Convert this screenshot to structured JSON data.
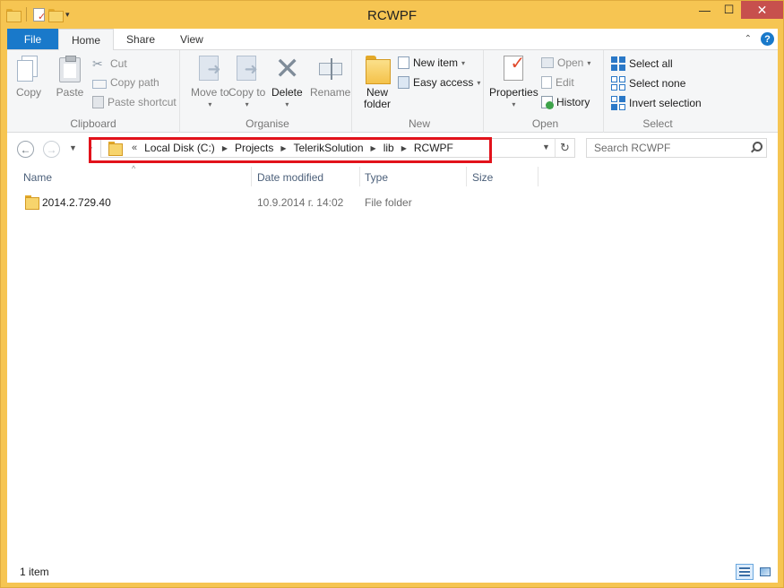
{
  "window": {
    "title": "RCWPF"
  },
  "ribbon_tabs": [
    {
      "label": "File"
    },
    {
      "label": "Home"
    },
    {
      "label": "Share"
    },
    {
      "label": "View"
    }
  ],
  "ribbon": {
    "clipboard": {
      "label": "Clipboard",
      "copy": "Copy",
      "paste": "Paste",
      "cut": "Cut",
      "copy_path": "Copy path",
      "paste_shortcut": "Paste shortcut"
    },
    "organise": {
      "label": "Organise",
      "move_to": "Move to",
      "copy_to": "Copy to",
      "delete": "Delete",
      "rename": "Rename"
    },
    "new": {
      "label": "New",
      "new_folder": "New folder",
      "new_item": "New item",
      "easy_access": "Easy access"
    },
    "open": {
      "label": "Open",
      "properties": "Properties",
      "open": "Open",
      "edit": "Edit",
      "history": "History"
    },
    "select": {
      "label": "Select",
      "select_all": "Select all",
      "select_none": "Select none",
      "invert_selection": "Invert selection"
    }
  },
  "address": {
    "overflow": "«",
    "crumbs": [
      "Local Disk (C:)",
      "Projects",
      "TelerikSolution",
      "lib",
      "RCWPF"
    ]
  },
  "search": {
    "placeholder": "Search RCWPF"
  },
  "columns": [
    "Name",
    "Date modified",
    "Type",
    "Size"
  ],
  "files": [
    {
      "name": "2014.2.729.40",
      "date_modified": "10.9.2014 г. 14:02",
      "type": "File folder",
      "size": ""
    }
  ],
  "status": {
    "item_count": "1 item"
  },
  "colors": {
    "title_bar": "#f6c552",
    "file_tab": "#1979ca",
    "close_button": "#c7504d",
    "highlight_box": "#e2121b"
  }
}
